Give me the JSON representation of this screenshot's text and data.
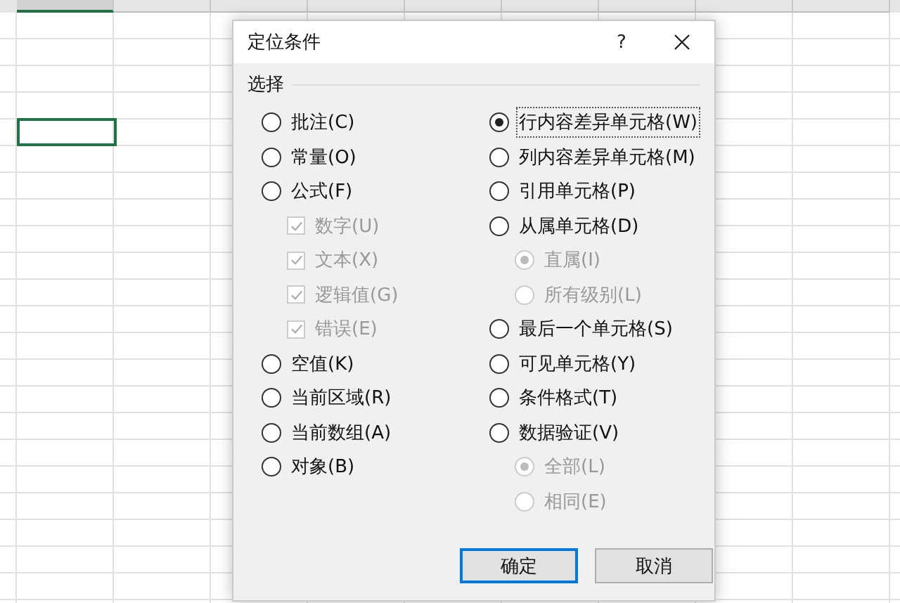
{
  "sheet": {
    "columns": [
      {
        "selected": true
      },
      {
        "selected": false
      },
      {
        "selected": false
      },
      {
        "selected": false
      },
      {
        "selected": false
      },
      {
        "selected": false
      },
      {
        "selected": false
      },
      {
        "selected": false
      },
      {
        "selected": false
      }
    ]
  },
  "dialog": {
    "title": "定位条件",
    "help": "?",
    "group": {
      "label": "选择",
      "left": [
        {
          "kind": "radio",
          "label": "批注(C)",
          "selected": false,
          "disabled": false
        },
        {
          "kind": "radio",
          "label": "常量(O)",
          "selected": false,
          "disabled": false
        },
        {
          "kind": "radio",
          "label": "公式(F)",
          "selected": false,
          "disabled": false,
          "children": [
            {
              "kind": "checkbox",
              "label": "数字(U)",
              "checked": true,
              "disabled": true
            },
            {
              "kind": "checkbox",
              "label": "文本(X)",
              "checked": true,
              "disabled": true
            },
            {
              "kind": "checkbox",
              "label": "逻辑值(G)",
              "checked": true,
              "disabled": true
            },
            {
              "kind": "checkbox",
              "label": "错误(E)",
              "checked": true,
              "disabled": true
            }
          ]
        },
        {
          "kind": "radio",
          "label": "空值(K)",
          "selected": false,
          "disabled": false
        },
        {
          "kind": "radio",
          "label": "当前区域(R)",
          "selected": false,
          "disabled": false
        },
        {
          "kind": "radio",
          "label": "当前数组(A)",
          "selected": false,
          "disabled": false
        },
        {
          "kind": "radio",
          "label": "对象(B)",
          "selected": false,
          "disabled": false
        }
      ],
      "right": [
        {
          "kind": "radio",
          "label": "行内容差异单元格(W)",
          "selected": true,
          "disabled": false,
          "focused": true
        },
        {
          "kind": "radio",
          "label": "列内容差异单元格(M)",
          "selected": false,
          "disabled": false
        },
        {
          "kind": "radio",
          "label": "引用单元格(P)",
          "selected": false,
          "disabled": false
        },
        {
          "kind": "radio",
          "label": "从属单元格(D)",
          "selected": false,
          "disabled": false,
          "children": [
            {
              "kind": "radio",
              "label": "直属(I)",
              "selected": true,
              "disabled": true
            },
            {
              "kind": "radio",
              "label": "所有级别(L)",
              "selected": false,
              "disabled": true
            }
          ]
        },
        {
          "kind": "radio",
          "label": "最后一个单元格(S)",
          "selected": false,
          "disabled": false
        },
        {
          "kind": "radio",
          "label": "可见单元格(Y)",
          "selected": false,
          "disabled": false
        },
        {
          "kind": "radio",
          "label": "条件格式(T)",
          "selected": false,
          "disabled": false
        },
        {
          "kind": "radio",
          "label": "数据验证(V)",
          "selected": false,
          "disabled": false,
          "children": [
            {
              "kind": "radio",
              "label": "全部(L)",
              "selected": true,
              "disabled": true
            },
            {
              "kind": "radio",
              "label": "相同(E)",
              "selected": false,
              "disabled": true
            }
          ]
        }
      ]
    },
    "buttons": [
      {
        "label": "确定",
        "default": true
      },
      {
        "label": "取消",
        "default": false
      }
    ]
  }
}
